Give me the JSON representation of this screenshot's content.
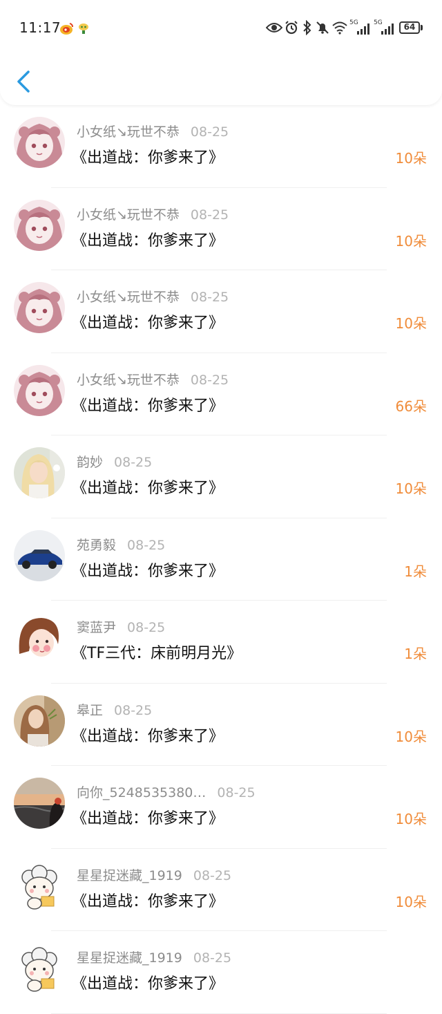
{
  "status_bar": {
    "time": "11:17",
    "battery": "64",
    "signal_label_1": "5G",
    "signal_label_2": "5G"
  },
  "colors": {
    "accent_back": "#2a9ae0",
    "amount": "#f08c3a"
  },
  "items": [
    {
      "name": "小女纸↘玩世不恭",
      "date": "08-25",
      "title": "《出道战：你爹来了》",
      "amount": "10朵",
      "avatar": "anime-girl-pink"
    },
    {
      "name": "小女纸↘玩世不恭",
      "date": "08-25",
      "title": "《出道战：你爹来了》",
      "amount": "10朵",
      "avatar": "anime-girl-pink"
    },
    {
      "name": "小女纸↘玩世不恭",
      "date": "08-25",
      "title": "《出道战：你爹来了》",
      "amount": "10朵",
      "avatar": "anime-girl-pink"
    },
    {
      "name": "小女纸↘玩世不恭",
      "date": "08-25",
      "title": "《出道战：你爹来了》",
      "amount": "66朵",
      "avatar": "anime-girl-pink"
    },
    {
      "name": "韵妙",
      "date": "08-25",
      "title": "《出道战：你爹来了》",
      "amount": "10朵",
      "avatar": "blonde-girl-photo"
    },
    {
      "name": "苑勇毅",
      "date": "08-25",
      "title": "《出道战：你爹来了》",
      "amount": "1朵",
      "avatar": "blue-car-photo"
    },
    {
      "name": "窦蓝尹",
      "date": "08-25",
      "title": "《TF三代：床前明月光》",
      "amount": "1朵",
      "avatar": "cartoon-girl-face"
    },
    {
      "name": "皋正",
      "date": "08-25",
      "title": "《出道战：你爹来了》",
      "amount": "10朵",
      "avatar": "woman-long-hair-photo"
    },
    {
      "name": "向你_5248535380…",
      "date": "08-25",
      "title": "《出道战：你爹来了》",
      "amount": "10朵",
      "avatar": "sunset-beach-photo"
    },
    {
      "name": "星星捉迷藏_1919",
      "date": "08-25",
      "title": "《出道战：你爹来了》",
      "amount": "10朵",
      "avatar": "cartoon-sheep"
    },
    {
      "name": "星星捉迷藏_1919",
      "date": "08-25",
      "title": "《出道战：你爹来了》",
      "amount": "",
      "avatar": "cartoon-sheep"
    }
  ]
}
